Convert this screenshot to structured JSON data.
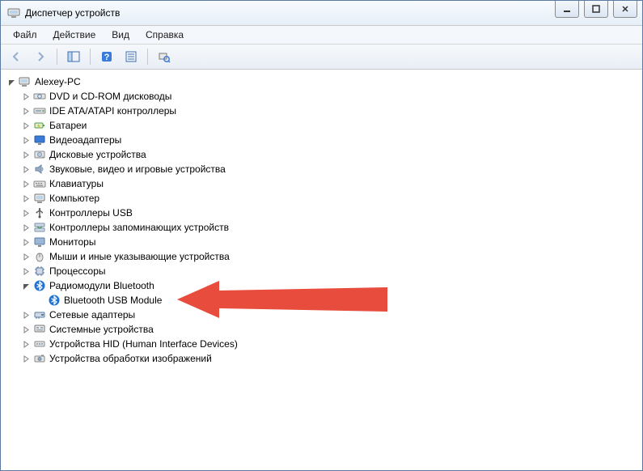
{
  "title": "Диспетчер устройств",
  "menu": {
    "file": "Файл",
    "action": "Действие",
    "view": "Вид",
    "help": "Справка"
  },
  "tree": {
    "root": {
      "label": "Alexey-PC",
      "expanded": true
    },
    "items": [
      {
        "label": "DVD и CD-ROM дисководы",
        "icon": "disc-drive-icon"
      },
      {
        "label": "IDE ATA/ATAPI контроллеры",
        "icon": "ide-controller-icon"
      },
      {
        "label": "Батареи",
        "icon": "battery-icon"
      },
      {
        "label": "Видеоадаптеры",
        "icon": "display-adapter-icon"
      },
      {
        "label": "Дисковые устройства",
        "icon": "disk-drive-icon"
      },
      {
        "label": "Звуковые, видео и игровые устройства",
        "icon": "sound-icon"
      },
      {
        "label": "Клавиатуры",
        "icon": "keyboard-icon"
      },
      {
        "label": "Компьютер",
        "icon": "computer-icon"
      },
      {
        "label": "Контроллеры USB",
        "icon": "usb-controller-icon"
      },
      {
        "label": "Контроллеры запоминающих устройств",
        "icon": "storage-controller-icon"
      },
      {
        "label": "Мониторы",
        "icon": "monitor-icon"
      },
      {
        "label": "Мыши и иные указывающие устройства",
        "icon": "mouse-icon"
      },
      {
        "label": "Процессоры",
        "icon": "processor-icon"
      },
      {
        "label": "Радиомодули Bluetooth",
        "icon": "bluetooth-icon",
        "expanded": true,
        "children": [
          {
            "label": "Bluetooth USB Module",
            "icon": "bluetooth-icon"
          }
        ]
      },
      {
        "label": "Сетевые адаптеры",
        "icon": "network-adapter-icon"
      },
      {
        "label": "Системные устройства",
        "icon": "system-device-icon"
      },
      {
        "label": "Устройства HID (Human Interface Devices)",
        "icon": "hid-device-icon"
      },
      {
        "label": "Устройства обработки изображений",
        "icon": "imaging-device-icon"
      }
    ]
  },
  "chart_data": null
}
